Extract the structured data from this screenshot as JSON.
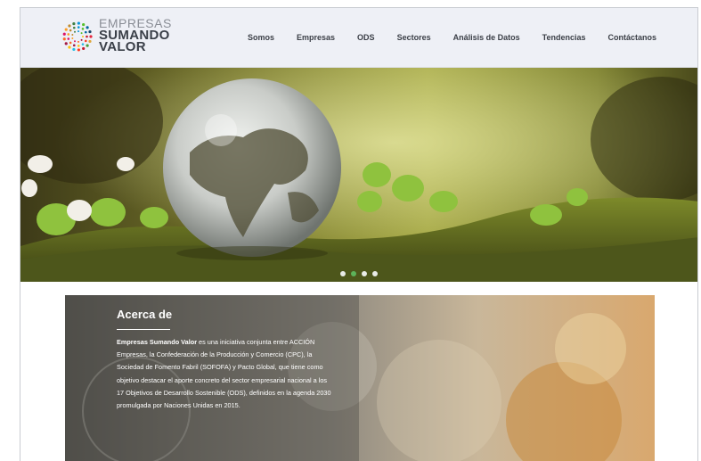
{
  "brand": {
    "line1": "EMPRESAS",
    "line2": "SUMANDO",
    "line3": "VALOR"
  },
  "nav": {
    "items": [
      "Somos",
      "Empresas",
      "ODS",
      "Sectores",
      "Análisis de Datos",
      "Tendencias",
      "Contáctanos"
    ]
  },
  "hero": {
    "slides": 4,
    "active_slide": 2
  },
  "about": {
    "title": "Acerca de",
    "lead": "Empresas Sumando Valor",
    "body": " es una iniciativa conjunta entre ACCIÓN Empresas, la Confederación de la Producción y Comercio (CPC), la Sociedad de Fomento Fabril (SOFOFA) y Pacto Global, que tiene como objetivo destacar el aporte concreto del sector empresarial nacional a los 17 Objetivos de Desarrollo Sostenible (ODS), definidos en la agenda 2030 promulgada por Naciones Unidas en 2015."
  },
  "colors": {
    "header_bg": "#eef0f6",
    "active_dot": "#5db25a"
  }
}
